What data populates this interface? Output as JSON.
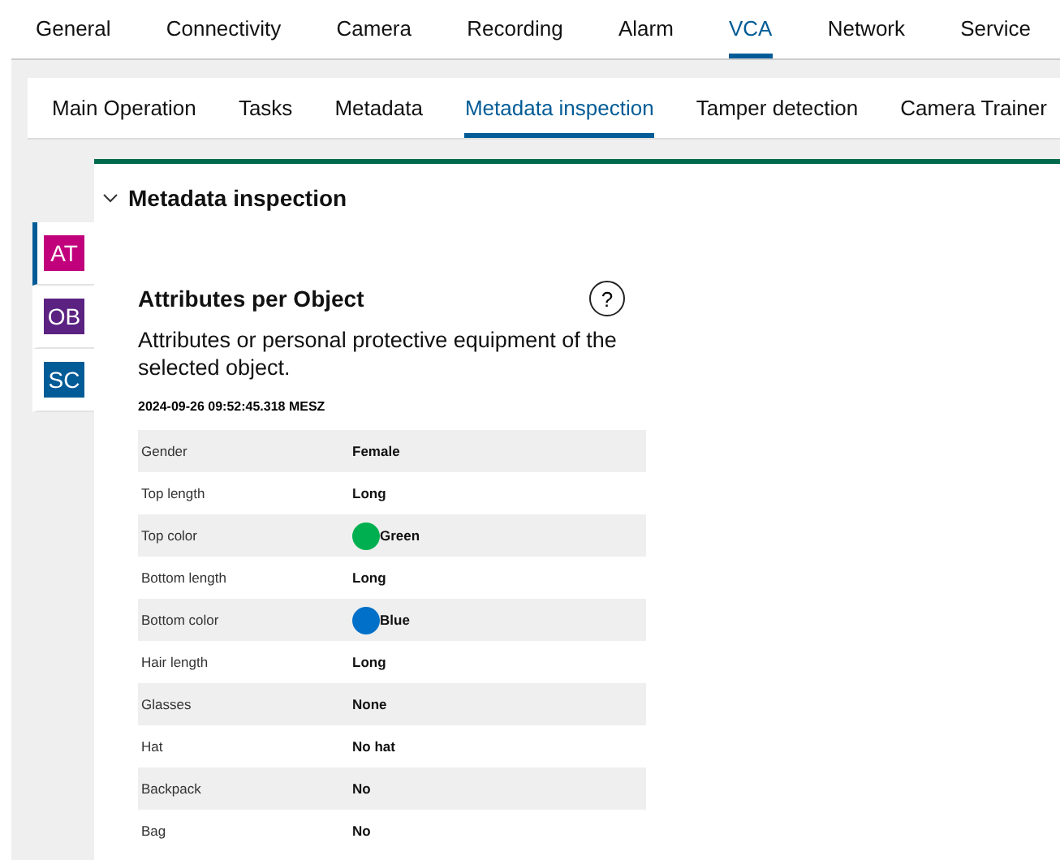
{
  "main_tabs": [
    {
      "label": "General",
      "selected": false
    },
    {
      "label": "Connectivity",
      "selected": false
    },
    {
      "label": "Camera",
      "selected": false
    },
    {
      "label": "Recording",
      "selected": false
    },
    {
      "label": "Alarm",
      "selected": false
    },
    {
      "label": "VCA",
      "selected": true
    },
    {
      "label": "Network",
      "selected": false
    },
    {
      "label": "Service",
      "selected": false
    }
  ],
  "sub_tabs": [
    {
      "label": "Main Operation",
      "selected": false
    },
    {
      "label": "Tasks",
      "selected": false
    },
    {
      "label": "Metadata",
      "selected": false
    },
    {
      "label": "Metadata inspection",
      "selected": true
    },
    {
      "label": "Tamper detection",
      "selected": false
    },
    {
      "label": "Camera Trainer",
      "selected": false
    }
  ],
  "section": {
    "title": "Metadata inspection",
    "expanded": true
  },
  "side_tabs": [
    {
      "label": "AT",
      "color": "#c1007c",
      "selected": true
    },
    {
      "label": "OB",
      "color": "#5b2282",
      "selected": false
    },
    {
      "label": "SC",
      "color": "#005b96",
      "selected": false
    }
  ],
  "card": {
    "title": "Attributes per Object",
    "help": "?",
    "description": "Attributes or personal protective equipment of the selected object.",
    "timestamp": "2024-09-26 09:52:45.318 MESZ"
  },
  "rows": [
    {
      "name": "Gender",
      "value": "Female"
    },
    {
      "name": "Top length",
      "value": "Long"
    },
    {
      "name": "Top color",
      "value": "Green",
      "color": "#00b050"
    },
    {
      "name": "Bottom length",
      "value": "Long"
    },
    {
      "name": "Bottom color",
      "value": "Blue",
      "color": "#0070c8"
    },
    {
      "name": "Hair length",
      "value": "Long"
    },
    {
      "name": "Glasses",
      "value": "None"
    },
    {
      "name": "Hat",
      "value": "No hat"
    },
    {
      "name": "Backpack",
      "value": "No"
    },
    {
      "name": "Bag",
      "value": "No"
    }
  ]
}
